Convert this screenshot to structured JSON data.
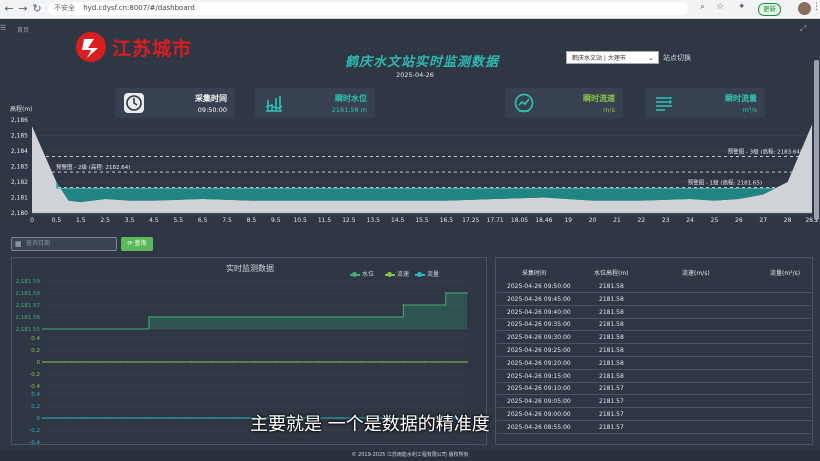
{
  "browser": {
    "security": "不安全",
    "url": "hyd.cdysf.cn:8007/#/dashboard",
    "update_label": "更新",
    "icons": [
      "back-icon",
      "forward-icon",
      "reload-icon",
      "home-icon",
      "zoom-icon",
      "star-icon",
      "extensions-icon",
      "profile-icon",
      "menu-icon"
    ]
  },
  "header": {
    "breadcrumb": "首页",
    "logo_text": "江苏城市",
    "title": "鹤庆水文站实时监测数据",
    "date": "2025-04-26",
    "station_select": "鹤庆水文站 | 大理市",
    "switch_label": "站点切换"
  },
  "cards": [
    {
      "label": "采集时间",
      "value": "09:50:00",
      "icon": "clock-icon",
      "label_color": "#ffffff",
      "value_color": "#ffffff"
    },
    {
      "label": "瞬时水位",
      "value": "2181.58 m",
      "icon": "water-level-icon",
      "label_color": "#2fc4b2",
      "value_color": "#2fc4b2"
    },
    {
      "label": "瞬时流速",
      "value": "m/s",
      "icon": "speed-gauge-icon",
      "label_color": "#8bc34a",
      "value_color": "#8bc34a"
    },
    {
      "label": "瞬时流量",
      "value": "m³/s",
      "icon": "flow-icon",
      "label_color": "#2fc4b2",
      "value_color": "#2fc4b2"
    }
  ],
  "chart_data": [
    {
      "type": "area",
      "ylabel": "高程(m)",
      "ylim": [
        2180,
        2186
      ],
      "yticks": [
        "2,186",
        "2,185",
        "2,184",
        "2,183",
        "2,182",
        "2,181",
        "2,180"
      ],
      "xticks": [
        "0",
        "0.5",
        "1.5",
        "2.5",
        "3.5",
        "4.5",
        "5.5",
        "6.5",
        "7.5",
        "8.5",
        "9.5",
        "10.5",
        "11.5",
        "12.5",
        "13.5",
        "14.5",
        "15.5",
        "16.5",
        "17.25",
        "17.71",
        "18.05",
        "18.46",
        "19",
        "20",
        "21",
        "22",
        "23",
        "24",
        "25",
        "26",
        "27",
        "28",
        "28.2"
      ],
      "annotations": [
        "预警图 - 2级 (高程: 2182.64)",
        "预警图 - 3级 (高程: 2183.64)",
        "预警图 - 1级 (高程: 2181.65)"
      ],
      "thresholds": [
        2182.64,
        2183.64,
        2181.65
      ],
      "water_level": 2181.58,
      "riverbed": {
        "x": [
          0,
          0.5,
          1,
          1.5,
          2.5,
          3.5,
          4.5,
          6.5,
          8.5,
          10.5,
          12.5,
          14.5,
          16.5,
          17.71,
          18.46,
          20,
          22,
          24,
          25,
          26,
          27,
          28,
          28.2
        ],
        "y": [
          2185.6,
          2182.0,
          2180.8,
          2180.7,
          2180.9,
          2180.8,
          2180.8,
          2180.9,
          2180.8,
          2180.8,
          2180.8,
          2180.8,
          2180.8,
          2180.9,
          2181.0,
          2180.8,
          2180.8,
          2180.9,
          2180.8,
          2180.9,
          2181.2,
          2182.0,
          2185.7
        ]
      },
      "colors": {
        "water": "#1f8e8a",
        "bed": "#cfd3d8",
        "threshold": "#d9dde3"
      }
    },
    {
      "type": "line",
      "title": "实时监测数据",
      "legend": [
        "水位",
        "流速",
        "流量"
      ],
      "legend_colors": [
        "#3fae77",
        "#8bc34a",
        "#29b6c6"
      ],
      "water_yticks": [
        "2,181.59",
        "2,181.58",
        "2,181.57",
        "2,181.56",
        "2,181.55"
      ],
      "speed_yticks": [
        "0.4",
        "0.2",
        "0",
        "-0.2",
        "-0.4"
      ],
      "flow_yticks": [
        "0.4",
        "0.2",
        "0",
        "-0.2",
        "-0.4"
      ],
      "series": [
        {
          "name": "水位",
          "values": [
            2181.55,
            2181.55,
            2181.55,
            2181.55,
            2181.55,
            2181.56,
            2181.56,
            2181.56,
            2181.56,
            2181.56,
            2181.56,
            2181.56,
            2181.56,
            2181.56,
            2181.56,
            2181.56,
            2181.56,
            2181.57,
            2181.57,
            2181.58,
            2181.58
          ]
        },
        {
          "name": "流速",
          "values": [
            0,
            0,
            0,
            0,
            0,
            0,
            0,
            0,
            0,
            0,
            0,
            0,
            0,
            0,
            0,
            0,
            0,
            0,
            0,
            0,
            0
          ]
        },
        {
          "name": "流量",
          "values": [
            0,
            0,
            0,
            0,
            0,
            0,
            0,
            0,
            0,
            0,
            0,
            0,
            0,
            0,
            0,
            0,
            0,
            0,
            0,
            0,
            0
          ]
        }
      ]
    }
  ],
  "query": {
    "placeholder": "查询日期",
    "button": "查询"
  },
  "table": {
    "headers": [
      "采集时间",
      "水位高程(m)",
      "流速(m/s)",
      "流量(m³/s)"
    ],
    "rows": [
      [
        "2025-04-26 09:50:00",
        "2181.58"
      ],
      [
        "2025-04-26 09:45:00",
        "2181.58"
      ],
      [
        "2025-04-26 09:40:00",
        "2181.58"
      ],
      [
        "2025-04-26 09:35:00",
        "2181.58"
      ],
      [
        "2025-04-26 09:30:00",
        "2181.58"
      ],
      [
        "2025-04-26 09:25:00",
        "2181.58"
      ],
      [
        "2025-04-26 09:20:00",
        "2181.58"
      ],
      [
        "2025-04-26 09:15:00",
        "2181.58"
      ],
      [
        "2025-04-26 09:10:00",
        "2181.57"
      ],
      [
        "2025-04-26 09:05:00",
        "2181.57"
      ],
      [
        "2025-04-26 09:00:00",
        "2181.57"
      ],
      [
        "2025-04-26 08:55:00",
        "2181.57"
      ]
    ]
  },
  "footer": "© 2019-2025 江苏雨能水利工程有限公司 版权所有",
  "subtitle": "主要就是 一个是数据的精准度"
}
